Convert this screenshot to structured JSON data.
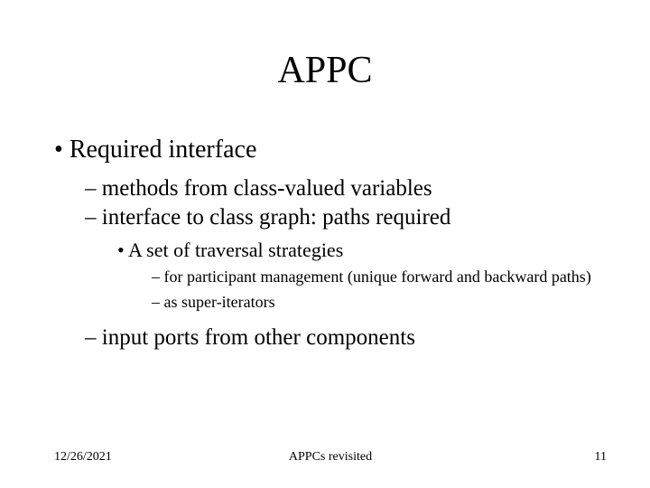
{
  "title": "APPC",
  "bullets": {
    "l1_0": "Required interface",
    "l2_0": "methods from class-valued variables",
    "l2_1": "interface to class graph: paths required",
    "l3_0": "A set of traversal strategies",
    "l4_0": "for participant management (unique forward and backward paths)",
    "l4_1": "as super-iterators",
    "l2_2": "input ports from other components"
  },
  "footer": {
    "date": "12/26/2021",
    "center": "APPCs revisited",
    "page": "11"
  }
}
